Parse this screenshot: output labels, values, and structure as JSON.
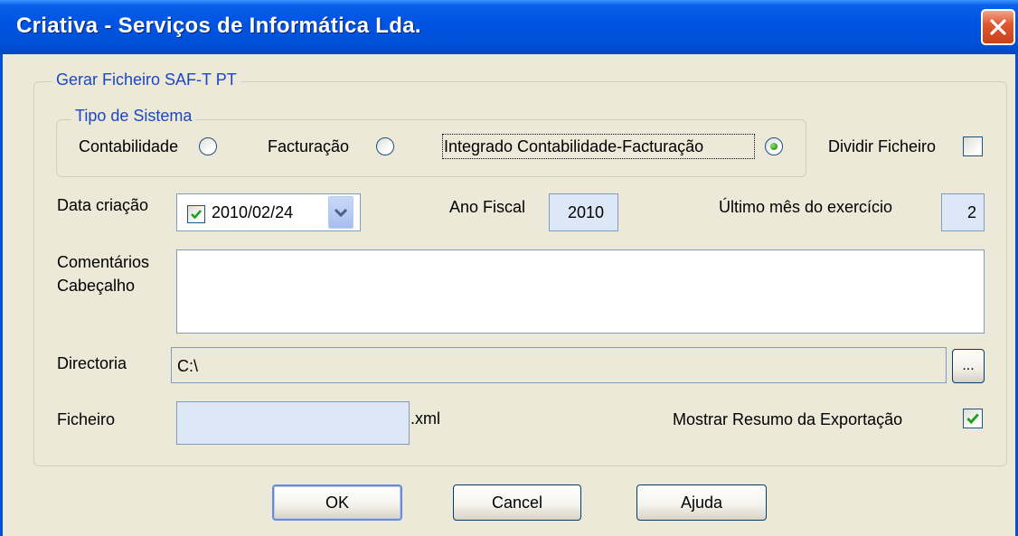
{
  "window": {
    "title": "Criativa - Serviços de Informática Lda."
  },
  "group_main": {
    "legend": "Gerar Ficheiro SAF-T PT"
  },
  "group_tipo": {
    "legend": "Tipo de Sistema",
    "options": [
      {
        "label": "Contabilidade",
        "selected": false
      },
      {
        "label": "Facturação",
        "selected": false
      },
      {
        "label": "Integrado Contabilidade-Facturação",
        "selected": true
      }
    ]
  },
  "dividir": {
    "label": "Dividir Ficheiro",
    "checked": false
  },
  "data_criacao": {
    "label": "Data criação",
    "value": "2010/02/24",
    "checked": true
  },
  "ano_fiscal": {
    "label": "Ano Fiscal",
    "value": "2010"
  },
  "ultimo_mes": {
    "label": "Último mês do exercício",
    "value": "2"
  },
  "comentarios": {
    "label_line1": "Comentários",
    "label_line2": "Cabeçalho",
    "value": ""
  },
  "directoria": {
    "label": "Directoria",
    "value": "C:\\",
    "browse_label": "..."
  },
  "ficheiro": {
    "label": "Ficheiro",
    "value": "",
    "extension": ".xml"
  },
  "mostrar_resumo": {
    "label": "Mostrar Resumo da Exportação",
    "checked": true
  },
  "buttons": {
    "ok": "OK",
    "cancel": "Cancel",
    "help": "Ajuda"
  },
  "colors": {
    "titlebar": "#0054e3",
    "legend_text": "#1c47c4",
    "field_bg": "#dce8f8"
  }
}
